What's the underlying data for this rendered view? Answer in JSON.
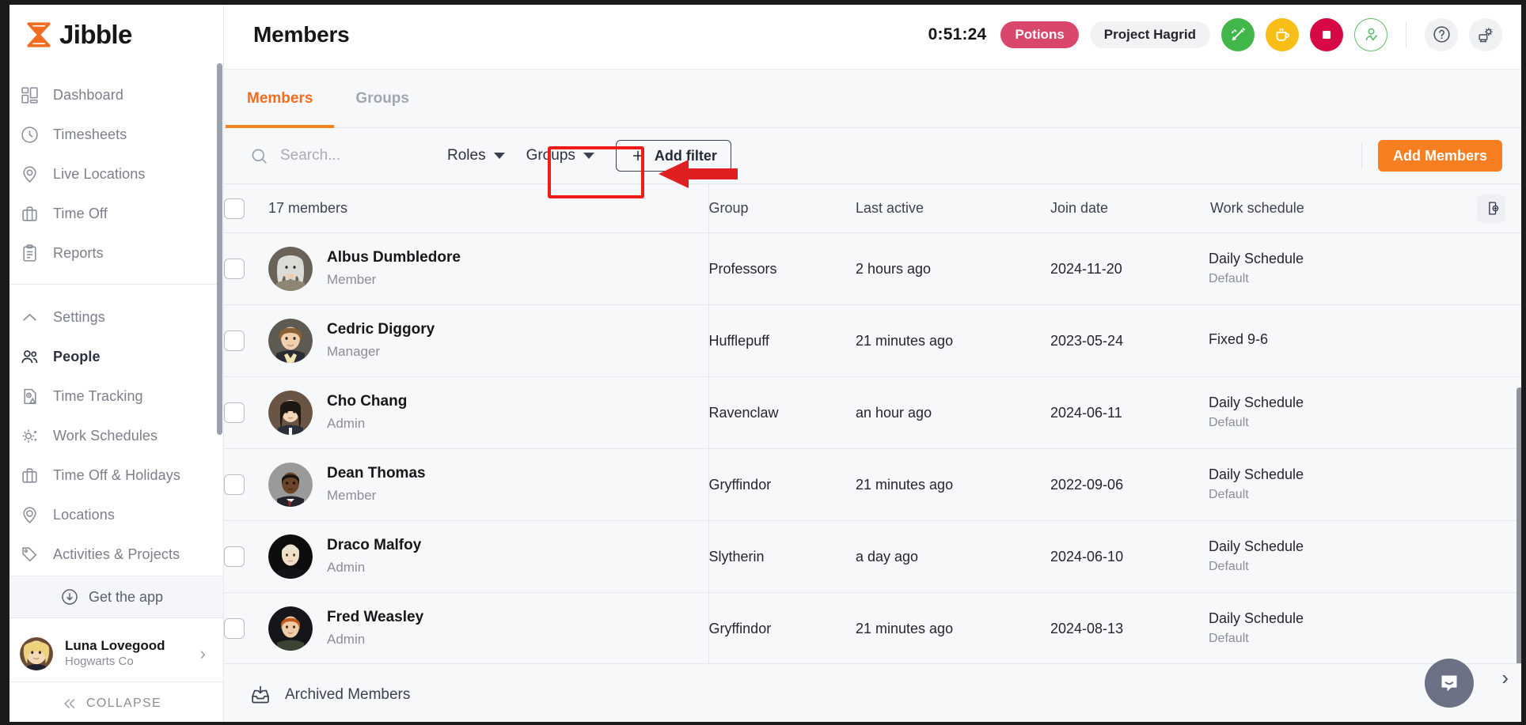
{
  "brand": {
    "name": "Jibble",
    "logo_icon": "hourglass-logo-icon",
    "accent": "#F36C21"
  },
  "sidebar": {
    "primary_items": [
      {
        "label": "Dashboard",
        "icon": "dashboard-icon"
      },
      {
        "label": "Timesheets",
        "icon": "clock-icon"
      },
      {
        "label": "Live Locations",
        "icon": "map-pin-icon"
      },
      {
        "label": "Time Off",
        "icon": "briefcase-icon"
      },
      {
        "label": "Reports",
        "icon": "clipboard-icon"
      }
    ],
    "settings_items": [
      {
        "label": "Settings",
        "icon": "chevron-up-icon",
        "active": false
      },
      {
        "label": "People",
        "icon": "people-icon",
        "active": true
      },
      {
        "label": "Time Tracking",
        "icon": "time-tracking-icon",
        "active": false
      },
      {
        "label": "Work Schedules",
        "icon": "work-schedules-icon",
        "active": false
      },
      {
        "label": "Time Off & Holidays",
        "icon": "briefcase-icon",
        "active": false
      },
      {
        "label": "Locations",
        "icon": "location-circle-icon",
        "active": false
      },
      {
        "label": "Activities & Projects",
        "icon": "tag-icon",
        "active": false
      }
    ],
    "get_the_app": {
      "label": "Get the app",
      "icon": "download-circle-icon"
    },
    "user": {
      "name": "Luna Lovegood",
      "org": "Hogwarts Co",
      "avatar": "luna-avatar",
      "chevron": "chevron-right-icon"
    },
    "collapse": {
      "label": "COLLAPSE",
      "icon": "double-chevron-left-icon"
    }
  },
  "header": {
    "title": "Members",
    "timer": "0:51:24",
    "activity_chip": {
      "label": "Potions",
      "color": "#D9476D"
    },
    "project_chip": {
      "label": "Project Hagrid",
      "color": "#F1F2F4"
    },
    "actions": [
      {
        "name": "switch-activity-button",
        "icon": "switch-activity-icon",
        "color": "#42B749"
      },
      {
        "name": "break-button",
        "icon": "coffee-cup-icon",
        "color": "#F8BD17"
      },
      {
        "name": "stop-timer-button",
        "icon": "stop-square-icon",
        "color": "#D50A44"
      },
      {
        "name": "clock-in-out-button",
        "icon": "person-check-icon",
        "color": "#5FBF6A"
      }
    ],
    "help": {
      "name": "help-button",
      "icon": "question-mark-icon"
    },
    "settings": {
      "name": "settings-button",
      "icon": "gear-kiosk-icon"
    }
  },
  "tabs": [
    {
      "label": "Members",
      "active": true
    },
    {
      "label": "Groups",
      "active": false,
      "annotated": true
    }
  ],
  "annotation": {
    "box_color": "#EF1C18",
    "arrow_color": "#E02020",
    "target": "Groups"
  },
  "filters": {
    "search_placeholder": "Search...",
    "search_value": "",
    "search_icon": "search-icon",
    "dropdowns": [
      {
        "label": "Roles",
        "icon": "chevron-down-icon"
      },
      {
        "label": "Groups",
        "icon": "chevron-down-icon"
      }
    ],
    "add_filter": {
      "label": "Add filter",
      "icon": "plus-icon"
    },
    "add_members": {
      "label": "Add Members",
      "color": "#F77F22"
    }
  },
  "table": {
    "count_label": "17 members",
    "columns": [
      "Group",
      "Last active",
      "Join date",
      "Work schedule"
    ],
    "export_icon": "export-column-icon",
    "rows": [
      {
        "name": "Albus Dumbledore",
        "role": "Member",
        "group": "Professors",
        "last_active": "2 hours ago",
        "join_date": "2024-11-20",
        "schedule": "Daily Schedule",
        "schedule_sub": "Default",
        "avatar": "albus-avatar",
        "checked": false
      },
      {
        "name": "Cedric Diggory",
        "role": "Manager",
        "group": "Hufflepuff",
        "last_active": "21 minutes ago",
        "join_date": "2023-05-24",
        "schedule": "Fixed 9-6",
        "schedule_sub": "",
        "avatar": "cedric-avatar",
        "checked": false
      },
      {
        "name": "Cho Chang",
        "role": "Admin",
        "group": "Ravenclaw",
        "last_active": "an hour ago",
        "join_date": "2024-06-11",
        "schedule": "Daily Schedule",
        "schedule_sub": "Default",
        "avatar": "cho-avatar",
        "checked": false
      },
      {
        "name": "Dean Thomas",
        "role": "Member",
        "group": "Gryffindor",
        "last_active": "21 minutes ago",
        "join_date": "2022-09-06",
        "schedule": "Daily Schedule",
        "schedule_sub": "Default",
        "avatar": "dean-avatar",
        "checked": false
      },
      {
        "name": "Draco Malfoy",
        "role": "Admin",
        "group": "Slytherin",
        "last_active": "a day ago",
        "join_date": "2024-06-10",
        "schedule": "Daily Schedule",
        "schedule_sub": "Default",
        "avatar": "draco-avatar",
        "checked": false
      },
      {
        "name": "Fred Weasley",
        "role": "Admin",
        "group": "Gryffindor",
        "last_active": "21 minutes ago",
        "join_date": "2024-08-13",
        "schedule": "Daily Schedule",
        "schedule_sub": "Default",
        "avatar": "fred-avatar",
        "checked": false
      }
    ]
  },
  "footer": {
    "label": "Archived Members",
    "icon": "archive-inbox-icon"
  },
  "intercom": {
    "icon": "chat-bubble-icon",
    "chevron": "chevron-right-icon"
  }
}
